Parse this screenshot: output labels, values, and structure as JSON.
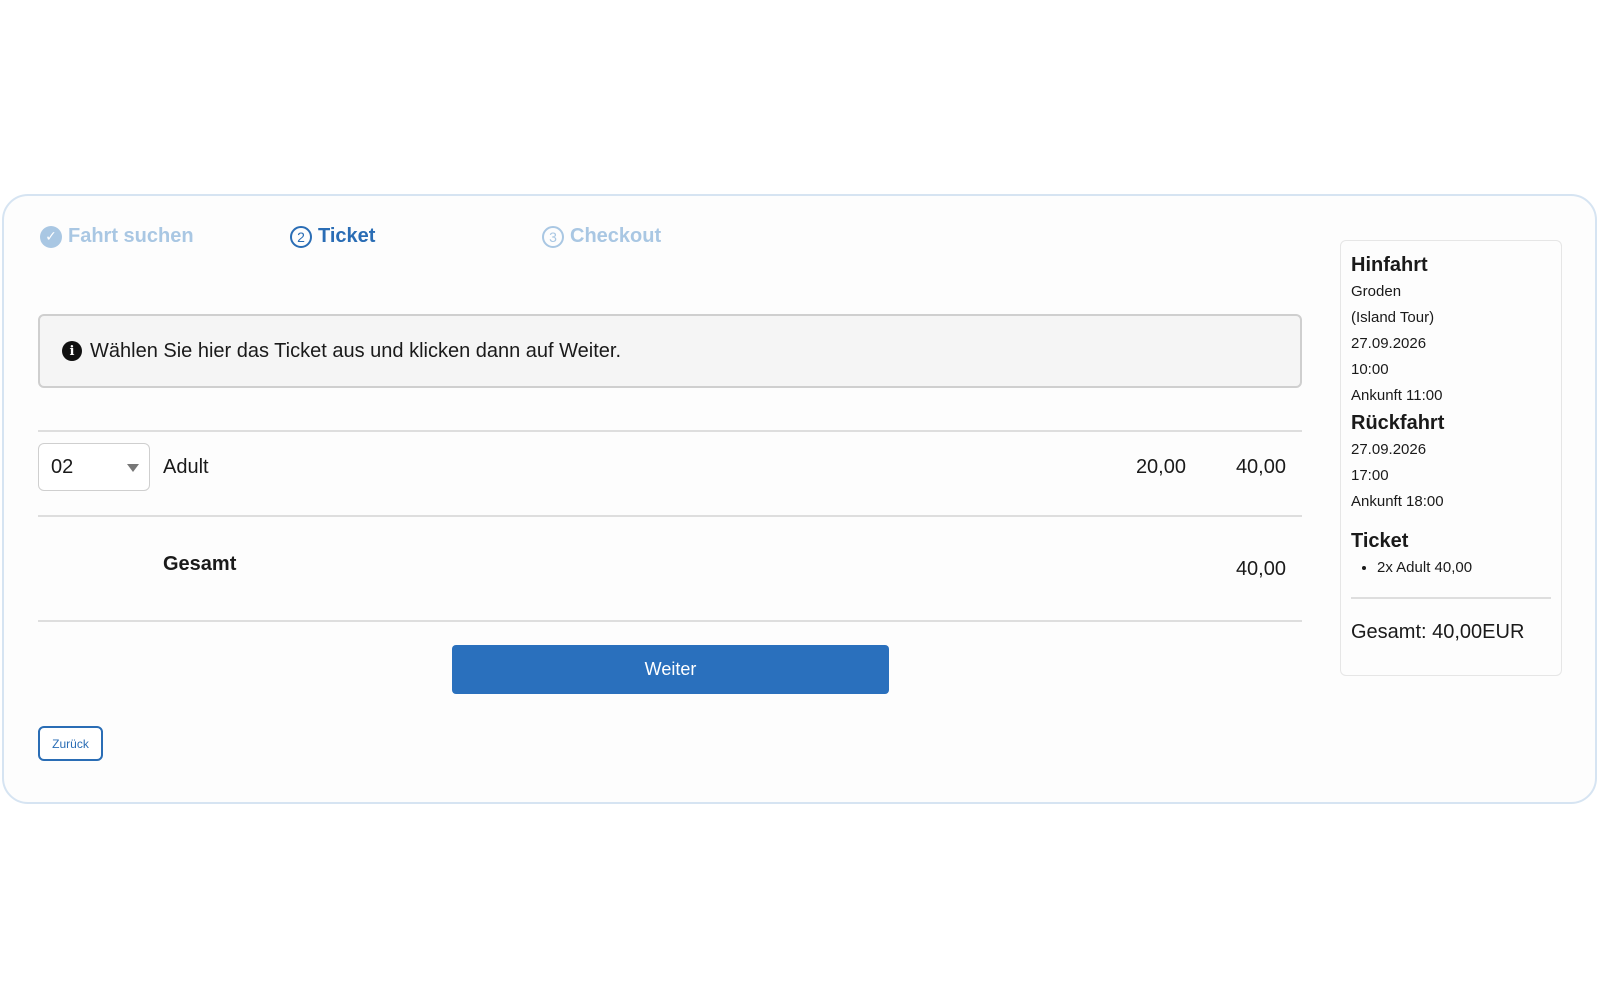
{
  "steps": [
    {
      "number": "✓",
      "label": "Fahrt suchen"
    },
    {
      "number": "2",
      "label": "Ticket"
    },
    {
      "number": "3",
      "label": "Checkout"
    }
  ],
  "info": {
    "icon": "info-icon",
    "text": "Wählen Sie hier das Ticket aus und klicken dann auf Weiter."
  },
  "ticket_row": {
    "quantity": "02",
    "label": "Adult",
    "unit_price": "20,00",
    "line_total": "40,00"
  },
  "total": {
    "label": "Gesamt",
    "value": "40,00"
  },
  "buttons": {
    "next": "Weiter",
    "back": "Zurück"
  },
  "summary": {
    "outbound": {
      "title": "Hinfahrt",
      "place": "Groden",
      "tour": "(Island Tour)",
      "date": "27.09.2026",
      "time": "10:00",
      "arrival": "Ankunft 11:00"
    },
    "return": {
      "title": "Rückfahrt",
      "date": "27.09.2026",
      "time": "17:00",
      "arrival": "Ankunft 18:00"
    },
    "ticket": {
      "title": "Ticket",
      "items": [
        "2x Adult 40,00"
      ]
    },
    "total": "Gesamt: 40,00EUR"
  },
  "colors": {
    "accent": "#2a6db5",
    "button": "#2a70bd",
    "step_inactive": "#a9c7e3"
  }
}
